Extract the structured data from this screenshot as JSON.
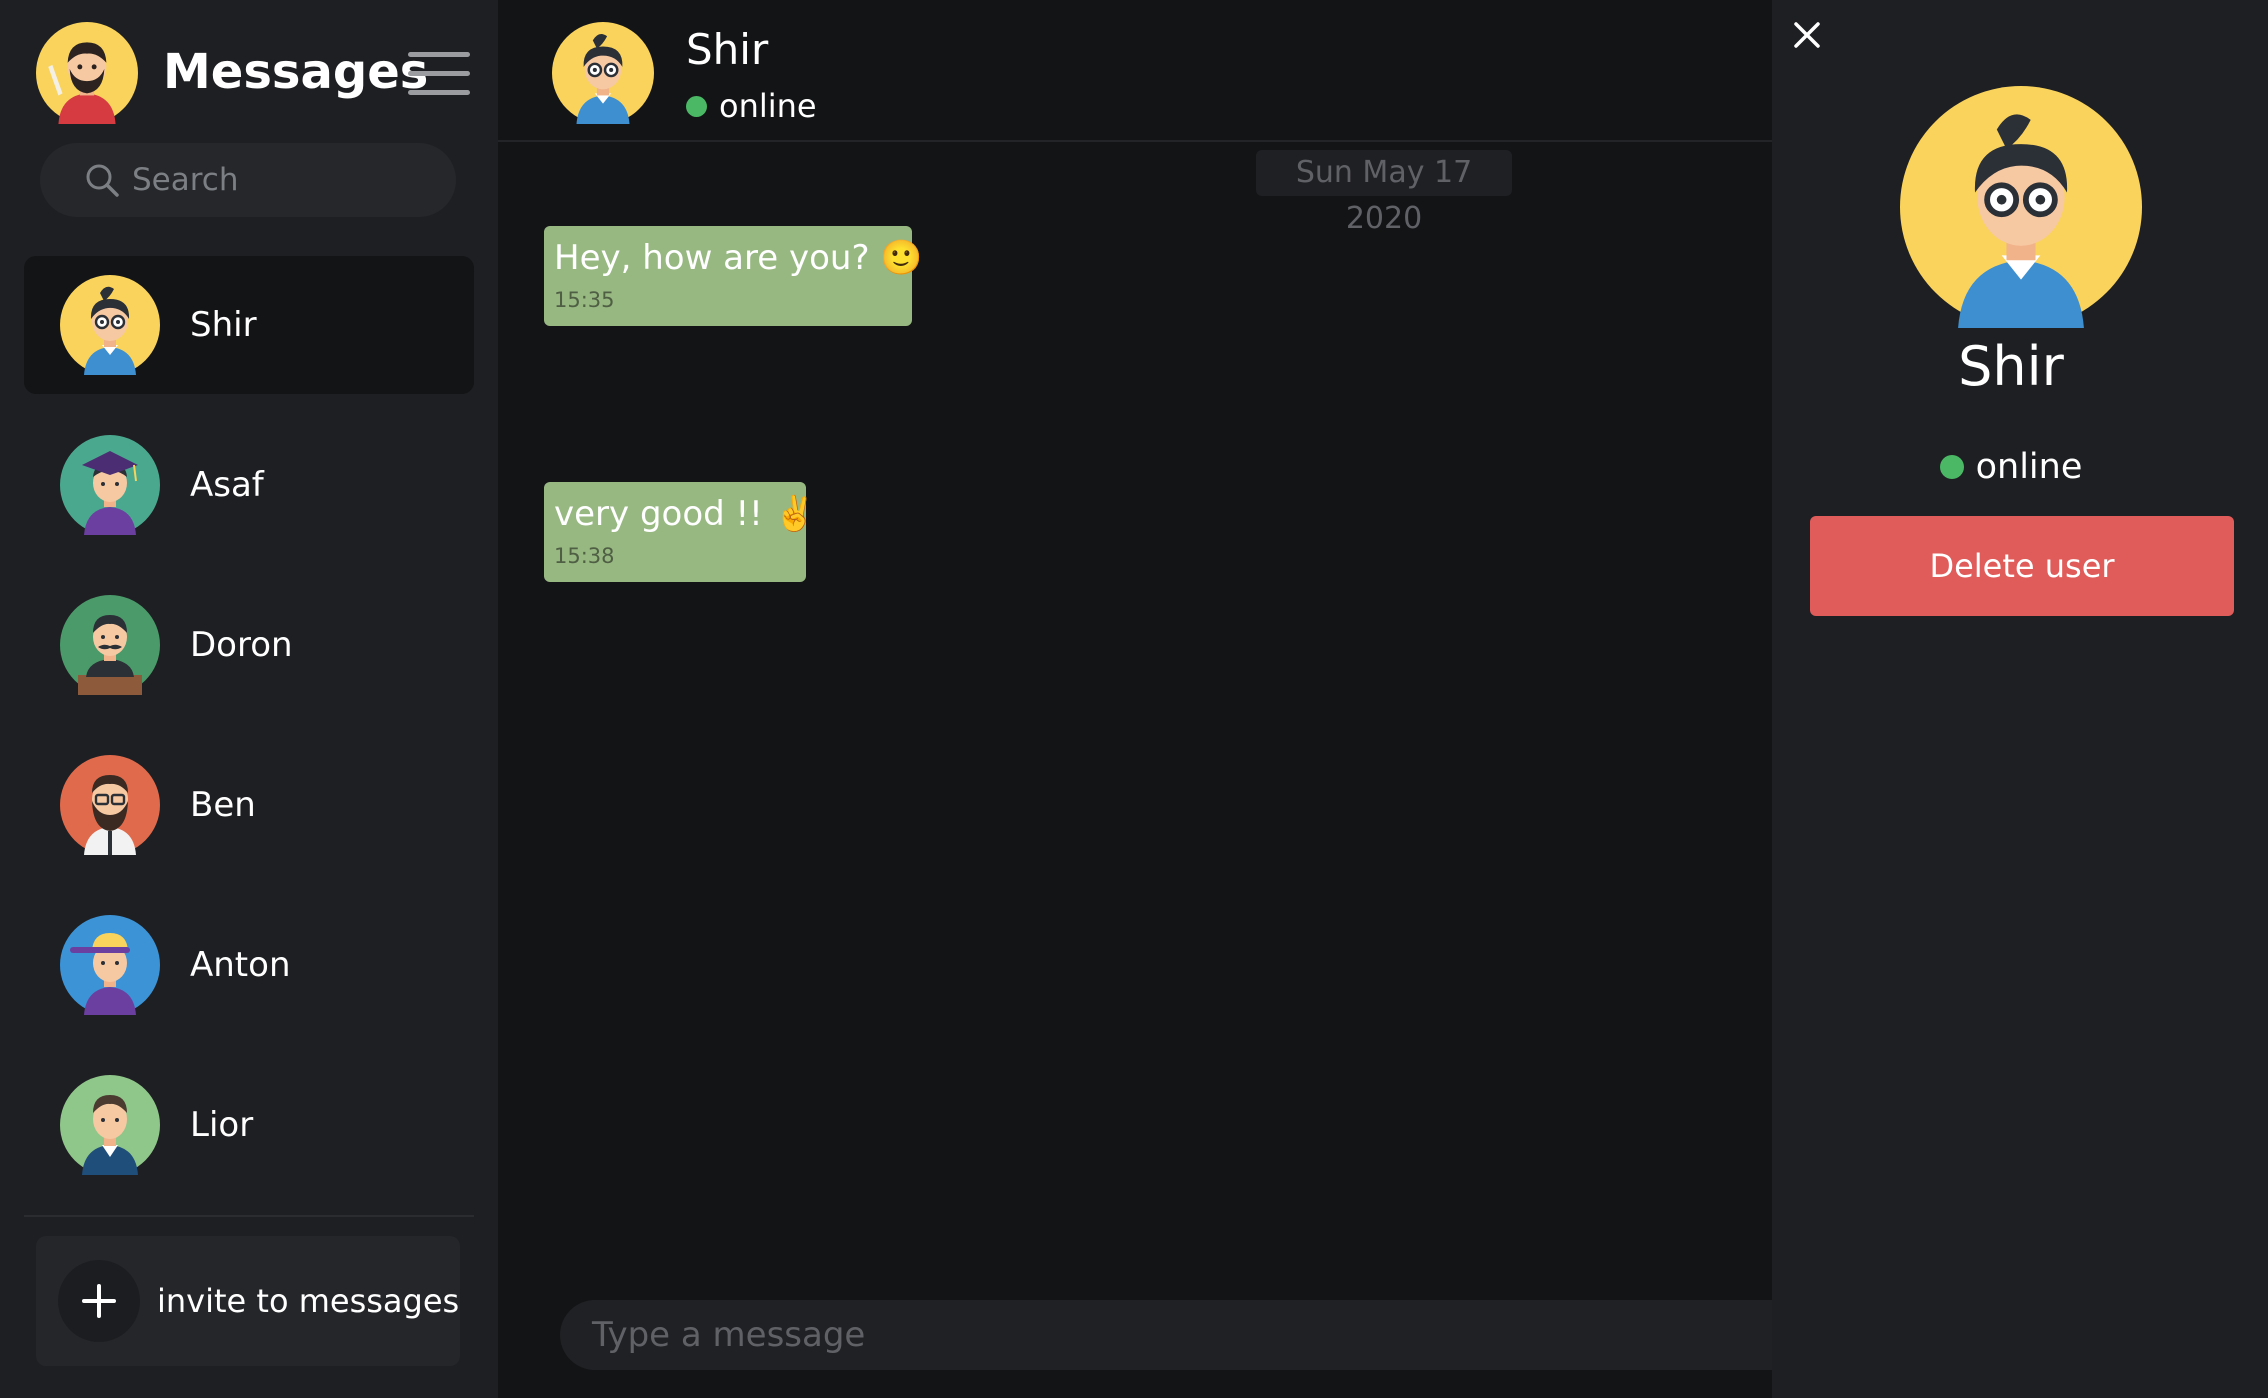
{
  "sidebar": {
    "title": "Messages",
    "search_placeholder": "Search",
    "contacts": [
      {
        "name": "Shir",
        "avatar": "woman-glasses-avatar"
      },
      {
        "name": "Asaf",
        "avatar": "graduate-avatar"
      },
      {
        "name": "Doron",
        "avatar": "mustache-man-avatar"
      },
      {
        "name": "Ben",
        "avatar": "bearded-man-avatar"
      },
      {
        "name": "Anton",
        "avatar": "cap-man-avatar"
      },
      {
        "name": "Lior",
        "avatar": "man-avatar"
      }
    ],
    "selected_contact": "Shir",
    "invite_label": "invite to messages"
  },
  "chat": {
    "contact_name": "Shir",
    "contact_status": "online",
    "date_separator": "Sun May 17 2020",
    "messages": [
      {
        "text": "Hey, how are you? 🙂",
        "time": "15:35"
      },
      {
        "text": "very good !! ✌️",
        "time": "15:38"
      }
    ],
    "composer_placeholder": "Type a message"
  },
  "profile": {
    "name": "Shir",
    "status": "online",
    "delete_label": "Delete user"
  },
  "colors": {
    "bubble": "#98b882",
    "online": "#4ab865",
    "danger": "#e05c5a",
    "sidebar_bg": "#1e1f22",
    "chat_bg": "#131416"
  }
}
